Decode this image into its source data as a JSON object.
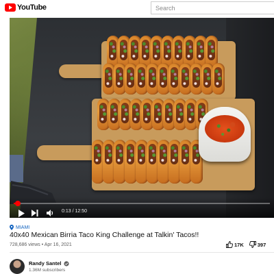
{
  "header": {
    "logo_text": "YouTube",
    "search_placeholder": "Search"
  },
  "player": {
    "current_time": "0:13",
    "duration": "12:50",
    "progress_fraction": 0.017
  },
  "video": {
    "location": "MIAMI",
    "title": "40x40 Mexican Birria Taco King Challenge at Talkin' Tacos!!",
    "views": "728,686 views",
    "date": "Apr 16, 2021",
    "likes": "17K",
    "dislikes": "397"
  },
  "channel": {
    "name": "Randy Santel",
    "subscribers": "1.36M subscribers",
    "verified_icon": "check-circle-icon"
  },
  "colors": {
    "brand_red": "#ff0000",
    "location_blue": "#1565c0"
  }
}
